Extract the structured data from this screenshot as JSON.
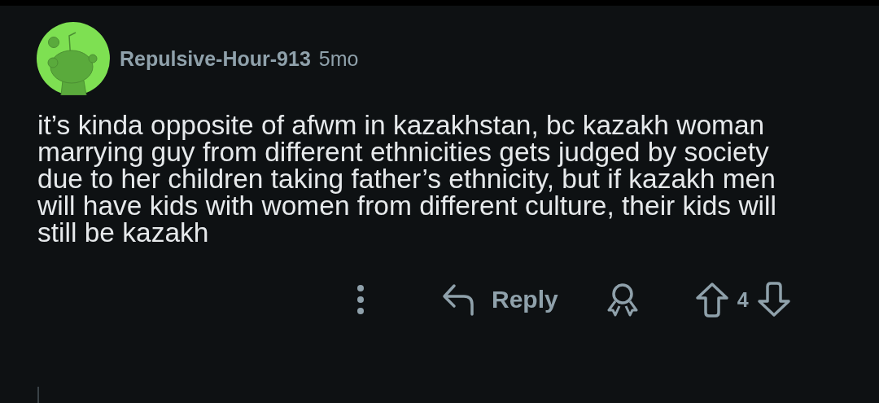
{
  "comment": {
    "author": "Repulsive-Hour-913",
    "age": "5mo",
    "body": "it’s kinda opposite of afwm in kazakhstan, bc kazakh woman marrying guy from different ethnicities gets judged by society due to her children taking father’s ethnicity, but if kazakh men will have kids with women from different culture, their kids will still be kazakh",
    "actions": {
      "reply": "Reply",
      "score": "4"
    }
  }
}
